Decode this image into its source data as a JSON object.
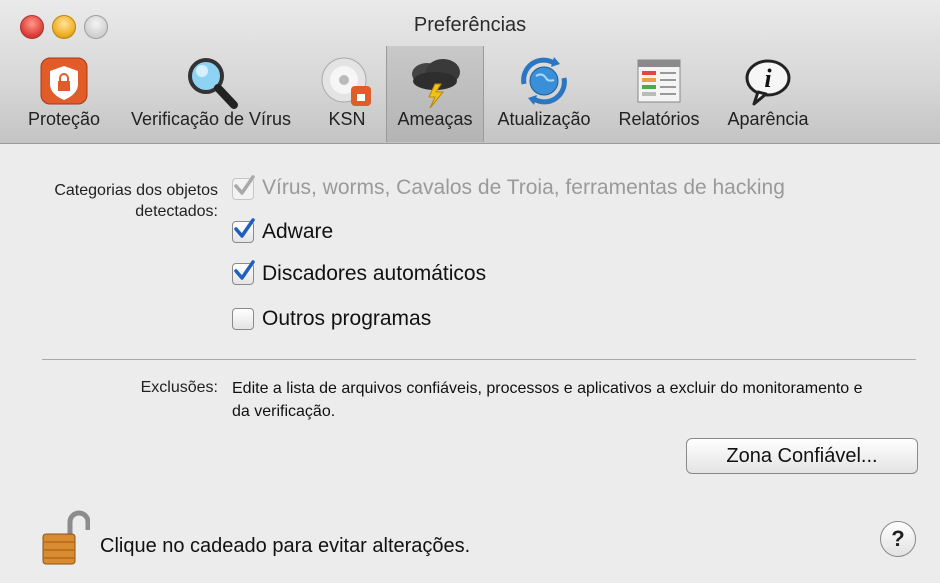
{
  "window": {
    "title": "Preferências"
  },
  "toolbar": {
    "items": [
      {
        "label": "Proteção",
        "icon": "shield-lock-icon"
      },
      {
        "label": "Verificação de Vírus",
        "icon": "magnifier-icon"
      },
      {
        "label": "KSN",
        "icon": "disc-shield-icon"
      },
      {
        "label": "Ameaças",
        "icon": "storm-cloud-icon",
        "selected": true
      },
      {
        "label": "Atualização",
        "icon": "globe-refresh-icon"
      },
      {
        "label": "Relatórios",
        "icon": "report-table-icon"
      },
      {
        "label": "Aparência",
        "icon": "info-bubble-icon"
      }
    ]
  },
  "categories": {
    "label": "Categorias dos objetos detectados:",
    "options": [
      {
        "label": "Vírus, worms, Cavalos de Troia, ferramentas de hacking",
        "checked": true,
        "disabled": true
      },
      {
        "label": "Adware",
        "checked": true,
        "disabled": false
      },
      {
        "label": "Discadores automáticos",
        "checked": true,
        "disabled": false
      },
      {
        "label": "Outros programas",
        "checked": false,
        "disabled": false
      }
    ]
  },
  "exclusions": {
    "label": "Exclusões:",
    "description": "Edite a lista de arquivos confiáveis, processos e aplicativos a excluir do monitoramento e da verificação.",
    "button": "Zona Confiável..."
  },
  "footer": {
    "lock_text": "Clique no cadeado para evitar alterações.",
    "help": "?"
  },
  "colors": {
    "check_blue": "#1f5fbf",
    "selected_tab": "#b8b8b8",
    "shield_orange": "#e25c2a"
  }
}
